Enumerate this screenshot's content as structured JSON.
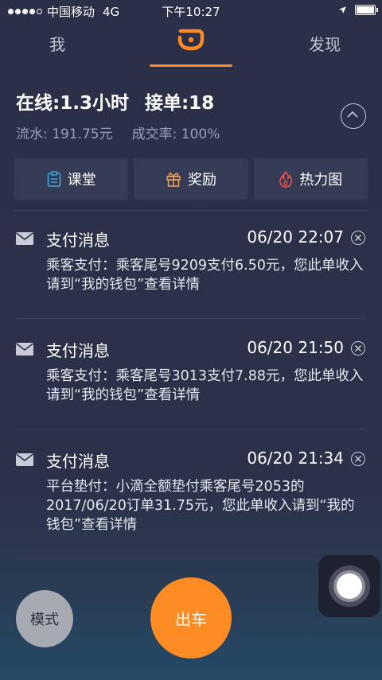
{
  "status_bar": {
    "carrier": "中国移动",
    "network": "4G",
    "time": "下午10:27"
  },
  "nav": {
    "tabs": [
      "我",
      "",
      "发现"
    ],
    "accent": "#fd8b26"
  },
  "stats": {
    "online": "在线:1.3小时",
    "orders": "接单:18",
    "turnover": "流水: 191.75元",
    "completion": "成交率: 100%"
  },
  "shortcuts": [
    {
      "label": "课堂",
      "icon": "clipboard-icon",
      "color": "#3aa6e3"
    },
    {
      "label": "奖励",
      "icon": "gift-icon",
      "color": "#f6a35a"
    },
    {
      "label": "热力图",
      "icon": "flame-icon",
      "color": "#ef4f4f"
    }
  ],
  "messages": [
    {
      "title": "支付消息",
      "time": "06/20 22:07",
      "body": "乘客支付：乘客尾号9209支付6.50元，您此单收入请到“我的钱包”查看详情"
    },
    {
      "title": "支付消息",
      "time": "06/20 21:50",
      "body": "乘客支付：乘客尾号3013支付7.88元，您此单收入请到“我的钱包”查看详情"
    },
    {
      "title": "支付消息",
      "time": "06/20 21:34",
      "body": "平台垫付：小滴全额垫付乘客尾号2053的2017/06/20订单31.75元，您此单收入请到“我的钱包”查看详情"
    }
  ],
  "bottom": {
    "mode_label": "模式",
    "go_label": "出车"
  }
}
